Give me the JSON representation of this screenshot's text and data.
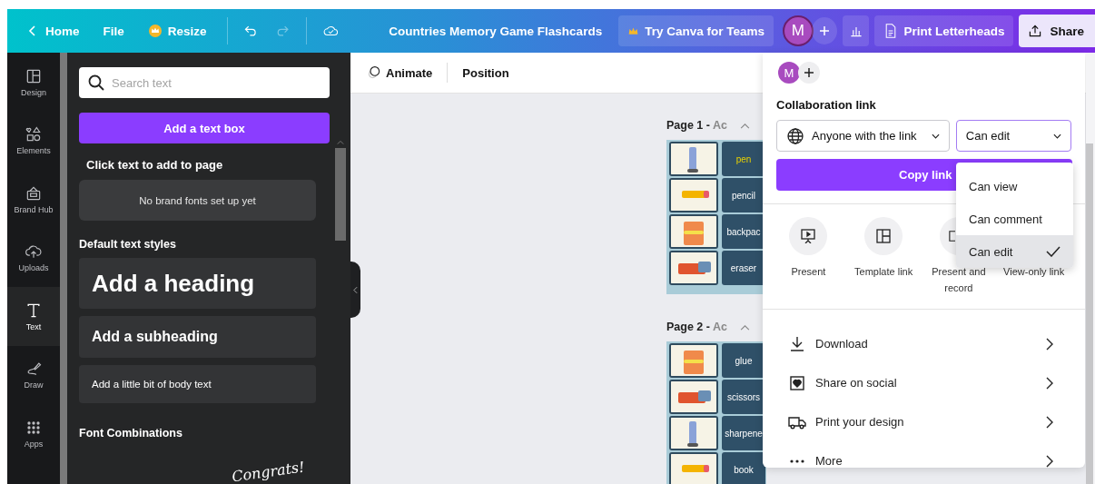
{
  "topbar": {
    "home": "Home",
    "file": "File",
    "resize": "Resize",
    "undo": {
      "disabled": false
    },
    "redo": {
      "disabled": true
    },
    "title": "Countries Memory Game Flashcards",
    "teams": "Try Canva for Teams",
    "avatar": "M",
    "print": "Print Letterheads",
    "share": "Share"
  },
  "sidebar": {
    "items": [
      {
        "kind": "design",
        "label": "Design",
        "selected": false
      },
      {
        "kind": "elements",
        "label": "Elements",
        "selected": false
      },
      {
        "kind": "brand",
        "label": "Brand Hub",
        "selected": false
      },
      {
        "kind": "uploads",
        "label": "Uploads",
        "selected": false
      },
      {
        "kind": "text",
        "label": "Text",
        "selected": true
      },
      {
        "kind": "draw",
        "label": "Draw",
        "selected": false
      },
      {
        "kind": "apps",
        "label": "Apps",
        "selected": false
      }
    ]
  },
  "text_panel": {
    "search": {
      "placeholder": "Search text"
    },
    "add_button": "Add a text box",
    "click_hint": "Click text to add to page",
    "brand_fonts": "No brand fonts set up yet",
    "default_heading": "Default text styles",
    "styles": [
      {
        "kind": "heading",
        "label": "Add a heading"
      },
      {
        "kind": "subheading",
        "label": "Add a subheading"
      },
      {
        "kind": "body",
        "label": "Add a little bit of body text"
      }
    ],
    "combinations_heading": "Font Combinations",
    "combination_preview": "Congrats!"
  },
  "context_toolbar": {
    "animate": "Animate",
    "position": "Position"
  },
  "pages": [
    {
      "label": "Page 1 -",
      "title": "Ac",
      "cards": [
        {
          "word": "pen",
          "highlighted": true
        },
        {
          "word": "pencil",
          "highlighted": false
        },
        {
          "word": "backpac",
          "highlighted": false
        },
        {
          "word": "eraser",
          "highlighted": false
        }
      ]
    },
    {
      "label": "Page 2 -",
      "title": "Ac",
      "cards": [
        {
          "word": "glue",
          "highlighted": false
        },
        {
          "word": "scissors",
          "highlighted": false
        },
        {
          "word": "sharpene",
          "highlighted": false
        },
        {
          "word": "book",
          "highlighted": false
        }
      ]
    }
  ],
  "share_panel": {
    "avatar": "M",
    "collab_heading": "Collaboration link",
    "access": "Anyone with the link",
    "permission": "Can edit",
    "copy": "Copy link",
    "options": [
      {
        "kind": "present",
        "label": "Present"
      },
      {
        "kind": "template",
        "label": "Template link"
      },
      {
        "kind": "record",
        "label": "Present and record"
      },
      {
        "kind": "view",
        "label": "View-only link"
      }
    ],
    "actions": [
      {
        "kind": "download",
        "label": "Download"
      },
      {
        "kind": "social",
        "label": "Share on social"
      },
      {
        "kind": "print",
        "label": "Print your design"
      },
      {
        "kind": "more",
        "label": "More"
      }
    ],
    "permission_menu": [
      {
        "label": "Can view",
        "selected": false
      },
      {
        "label": "Can comment",
        "selected": false
      },
      {
        "label": "Can edit",
        "selected": true
      }
    ]
  }
}
